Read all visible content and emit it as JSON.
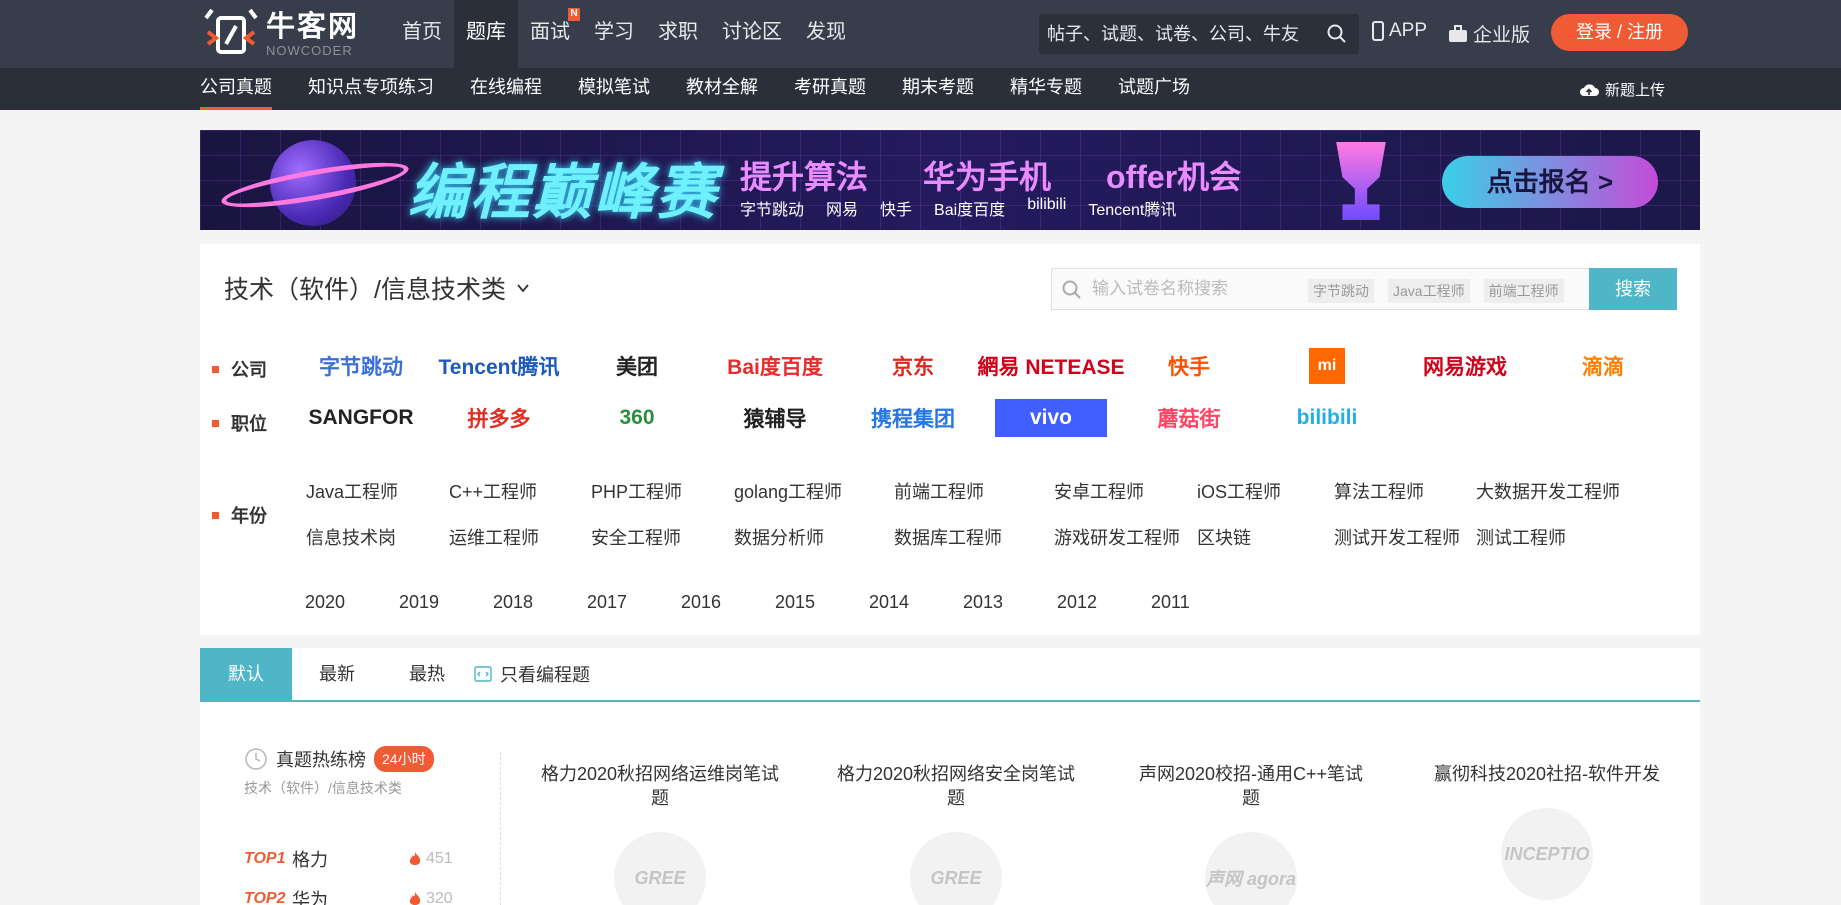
{
  "header": {
    "logo_cn": "牛客网",
    "logo_en": "NOWCODER",
    "nav": [
      {
        "label": "首页",
        "active": false
      },
      {
        "label": "题库",
        "active": true
      },
      {
        "label": "面试",
        "active": false,
        "badge": "N"
      },
      {
        "label": "学习",
        "active": false
      },
      {
        "label": "求职",
        "active": false
      },
      {
        "label": "讨论区",
        "active": false
      },
      {
        "label": "发现",
        "active": false
      }
    ],
    "search_placeholder": "帖子、试题、试卷、公司、牛友",
    "app_label": "APP",
    "enterprise_label": "企业版",
    "login_label": "登录 / 注册"
  },
  "subnav": {
    "items": [
      "公司真题",
      "知识点专项练习",
      "在线编程",
      "模拟笔试",
      "教材全解",
      "考研真题",
      "期末考题",
      "精华专题",
      "试题广场"
    ],
    "upload_label": "新题上传"
  },
  "banner": {
    "title": "编程巅峰赛",
    "slogans": [
      "提升算法",
      "华为手机",
      "offer机会"
    ],
    "brands": [
      "字节跳动",
      "网易",
      "快手",
      "Bai度百度",
      "bilibili",
      "Tencent腾讯"
    ],
    "button": "点击报名 >"
  },
  "filter": {
    "category": "技术（软件）/信息技术类",
    "search_placeholder": "输入试卷名称搜索",
    "tags": [
      "字节跳动",
      "Java工程师",
      "前端工程师"
    ],
    "search_button": "搜索",
    "company_label": "公司",
    "companies": [
      {
        "name": "字节跳动",
        "color": "#3c6fd8"
      },
      {
        "name": "Tencent腾讯",
        "color": "#1e5bb8"
      },
      {
        "name": "美团",
        "color": "#222"
      },
      {
        "name": "Bai度百度",
        "color": "#e62c2c"
      },
      {
        "name": "京东",
        "color": "#e1251b"
      },
      {
        "name": "網易 NETEASE",
        "color": "#d0021b"
      },
      {
        "name": "快手",
        "color": "#ff5000"
      },
      {
        "name": "mi",
        "color": "#ff6700"
      },
      {
        "name": "网易游戏",
        "color": "#d0021b"
      },
      {
        "name": "滴滴",
        "color": "#ff7f00"
      },
      {
        "name": "SANGFOR",
        "color": "#222"
      },
      {
        "name": "拼多多",
        "color": "#e02e24"
      },
      {
        "name": "360",
        "color": "#2a8f3c"
      },
      {
        "name": "猿辅导",
        "color": "#222"
      },
      {
        "name": "携程集团",
        "color": "#2577e3"
      },
      {
        "name": "vivo",
        "color": "#ffffff"
      },
      {
        "name": "蘑菇街",
        "color": "#ff4466"
      },
      {
        "name": "bilibili",
        "color": "#23ade5"
      }
    ],
    "job_label": "职位",
    "jobs": [
      "Java工程师",
      "C++工程师",
      "PHP工程师",
      "golang工程师",
      "前端工程师",
      "安卓工程师",
      "iOS工程师",
      "算法工程师",
      "大数据开发工程师",
      "信息技术岗",
      "运维工程师",
      "安全工程师",
      "数据分析师",
      "数据库工程师",
      "游戏研发工程师",
      "区块链",
      "测试开发工程师",
      "测试工程师"
    ],
    "year_label": "年份",
    "years": [
      "2020",
      "2019",
      "2018",
      "2017",
      "2016",
      "2015",
      "2014",
      "2013",
      "2012",
      "2011"
    ]
  },
  "tabs": {
    "items": [
      "默认",
      "最新",
      "最热"
    ],
    "code_only": "只看编程题"
  },
  "hot": {
    "title": "真题热练榜",
    "badge": "24小时",
    "sub": "技术（软件）/信息技术类",
    "ranks": [
      {
        "tag": "TOP1",
        "name": "格力",
        "count": "451"
      },
      {
        "tag": "TOP2",
        "name": "华为",
        "count": "320"
      }
    ]
  },
  "cards": [
    {
      "title": "格力2020秋招网络运维岗笔试题",
      "logo": "GREE"
    },
    {
      "title": "格力2020秋招网络安全岗笔试题",
      "logo": "GREE"
    },
    {
      "title": "声网2020校招-通用C++笔试题",
      "logo": "声网 agora"
    },
    {
      "title": "赢彻科技2020社招-软件开发",
      "logo": "INCEPTIO"
    }
  ],
  "colors": {
    "accent": "#ee5b34",
    "teal": "#4fb6c8",
    "topbar": "#373d4a"
  }
}
